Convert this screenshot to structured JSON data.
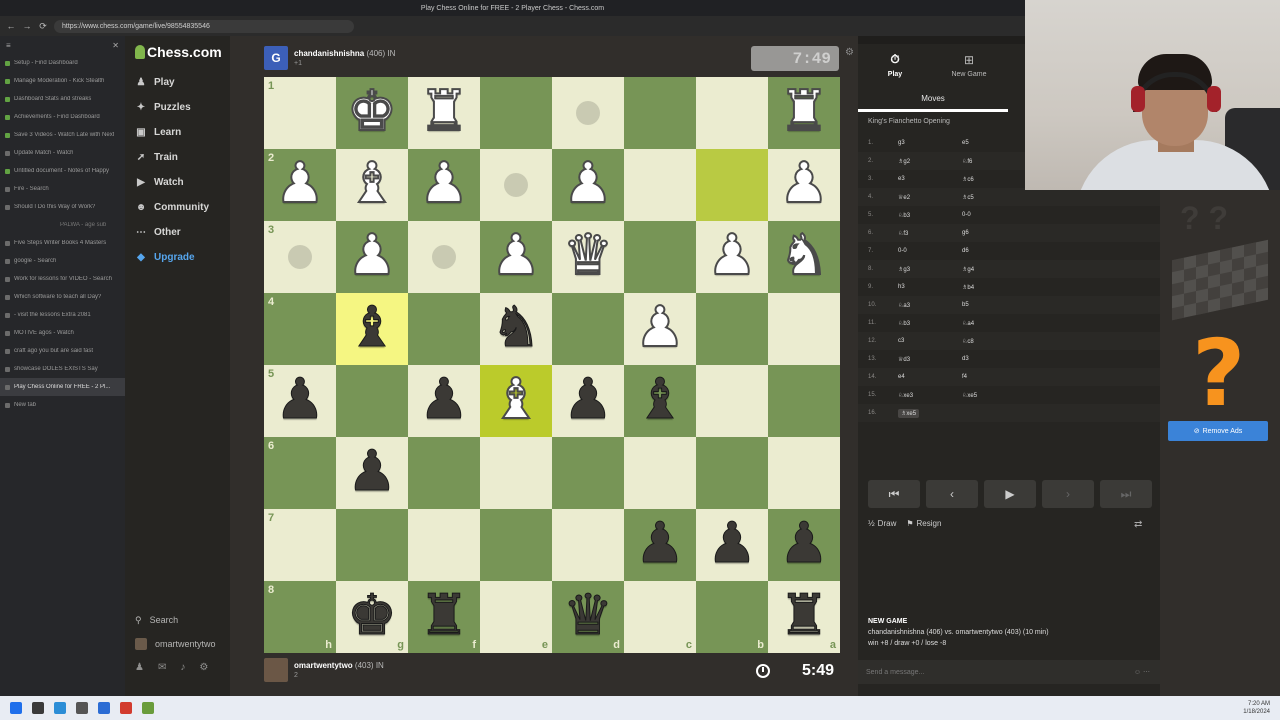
{
  "browser": {
    "window_title": "Play Chess Online for FREE - 2 Player Chess - Chess.com",
    "url": "https://www.chess.com/game/live/98554835546",
    "back_glyph": "←",
    "forward_glyph": "→",
    "reload_glyph": "⟳",
    "tabs_header_glyph": "≡",
    "tabs_close_glyph": "✕",
    "tabs": [
      {
        "label": "Setup - Find Dashboard",
        "green": true,
        "sub": false
      },
      {
        "label": "Manage Moderation - Kick Stealth",
        "green": true,
        "sub": false
      },
      {
        "label": "Dashboard Stats and streaks",
        "green": true,
        "sub": false
      },
      {
        "label": "Achievements - Find Dashboard",
        "green": true,
        "sub": false
      },
      {
        "label": "Save 3 Videos - Watch Late with Next",
        "green": true,
        "sub": false
      },
      {
        "label": "Update Match - Watch",
        "green": false,
        "sub": false
      },
      {
        "label": "Untitled document - Notes of Happy",
        "green": true,
        "sub": false
      },
      {
        "label": "Fire - Search",
        "green": false,
        "sub": false
      },
      {
        "label": "Should I Do this Way of Work?",
        "green": false,
        "sub": false
      },
      {
        "label": "PALWA - age sub",
        "green": false,
        "sub": true
      },
      {
        "label": "Five Steps Writer Books 4 Masters",
        "green": false,
        "sub": false
      },
      {
        "label": "google - Search",
        "green": false,
        "sub": false
      },
      {
        "label": "Work for lessons for VIDEO - Search",
        "green": false,
        "sub": false
      },
      {
        "label": "Which software to teach all Day?",
        "green": false,
        "sub": false
      },
      {
        "label": "- visit the lessons Extra 2081",
        "green": false,
        "sub": false
      },
      {
        "label": "MOTIVE agos - Watch",
        "green": false,
        "sub": false
      },
      {
        "label": "craft ago you but are said fast",
        "green": false,
        "sub": false
      },
      {
        "label": "showcase DOLES EXISTS Say",
        "green": false,
        "sub": false
      },
      {
        "label": "Play Chess Online for FREE - 2 Pl...",
        "green": false,
        "sub": false,
        "active": true
      },
      {
        "label": "New tab",
        "green": false,
        "sub": false
      }
    ]
  },
  "sidebar": {
    "logo": "Chess.com",
    "items": [
      {
        "label": "Play",
        "icon": "♟"
      },
      {
        "label": "Puzzles",
        "icon": "✦"
      },
      {
        "label": "Learn",
        "icon": "▣"
      },
      {
        "label": "Train",
        "icon": "➚"
      },
      {
        "label": "Watch",
        "icon": "▶"
      },
      {
        "label": "Community",
        "icon": "☻"
      },
      {
        "label": "Other",
        "icon": "⋯"
      },
      {
        "label": "Upgrade",
        "icon": "◆"
      }
    ],
    "search_label": "Search",
    "search_icon": "⚲",
    "username": "omartwentytwo",
    "bottom_icons": [
      "♟",
      "✉",
      "♪",
      "⚙"
    ]
  },
  "game": {
    "top_player": {
      "name": "chandanishnishna",
      "rating": "(406)",
      "flag": "IN",
      "avatar_letter": "G",
      "sub": "+1",
      "clock": "7:49"
    },
    "bottom_player": {
      "name": "omartwentytwo",
      "rating": "(403)",
      "flag": "IN",
      "sub": "2",
      "clock": "5:49"
    },
    "board": {
      "rank_labels": [
        "1",
        "2",
        "3",
        "4",
        "5",
        "6",
        "7",
        "8"
      ],
      "file_labels": [
        "h",
        "g",
        "f",
        "e",
        "d",
        "c",
        "b",
        "a"
      ],
      "pieces": [
        [
          "",
          "wK",
          "wR",
          "",
          ".",
          "",
          "",
          "wR"
        ],
        [
          "wP",
          "wB",
          "wP",
          ".",
          "wP",
          "",
          "",
          "wP"
        ],
        [
          ".",
          "wP",
          ".",
          "wP",
          "wQ",
          "",
          "wP",
          "wN"
        ],
        [
          "",
          "bB",
          "",
          "bN",
          "",
          "wP",
          "",
          ""
        ],
        [
          "bP",
          "",
          "bP",
          "wB",
          "bP",
          "bB",
          "",
          ""
        ],
        [
          "",
          "bP",
          "",
          "",
          "",
          "",
          "",
          ""
        ],
        [
          "",
          "",
          "",
          "",
          "",
          "bP",
          "bP",
          "bP"
        ],
        [
          "",
          "bK",
          "bR",
          "",
          "bQ",
          "",
          "",
          "bR"
        ]
      ],
      "highlights": [
        {
          "r": 1,
          "c": 6,
          "kind": "hl-dark"
        },
        {
          "r": 3,
          "c": 1,
          "kind": "hl-light"
        },
        {
          "r": 4,
          "c": 3,
          "kind": "hl-dark2"
        }
      ]
    }
  },
  "panel": {
    "tabs": [
      {
        "label": "Play",
        "icon": "⏱",
        "active": true
      },
      {
        "label": "New Game",
        "icon": "⊞",
        "active": false
      }
    ],
    "moves_header": "Moves",
    "opening": "King's Fianchetto Opening",
    "moves": [
      {
        "n": "1.",
        "w": "g3",
        "b": "e5"
      },
      {
        "n": "2.",
        "w": "♗g2",
        "b": "♘f6"
      },
      {
        "n": "3.",
        "w": "e3",
        "b": "♗c6"
      },
      {
        "n": "4.",
        "w": "♕e2",
        "b": "♗c5"
      },
      {
        "n": "5.",
        "w": "♘b3",
        "b": "0-0"
      },
      {
        "n": "6.",
        "w": "♘f3",
        "b": "g6"
      },
      {
        "n": "7.",
        "w": "0-0",
        "b": "d6"
      },
      {
        "n": "8.",
        "w": "♗g3",
        "b": "♗g4"
      },
      {
        "n": "9.",
        "w": "h3",
        "b": "♗b4"
      },
      {
        "n": "10.",
        "w": "♘a3",
        "b": "b5"
      },
      {
        "n": "11.",
        "w": "♘b3",
        "b": "♘a4"
      },
      {
        "n": "12.",
        "w": "c3",
        "b": "♘c8"
      },
      {
        "n": "13.",
        "w": "♕d3",
        "b": "d3"
      },
      {
        "n": "14.",
        "w": "e4",
        "b": "f4"
      },
      {
        "n": "15.",
        "w": "♘xe3",
        "b": "♘xe5"
      },
      {
        "n": "16.",
        "w": "♗xe5",
        "b": "",
        "current": true
      }
    ],
    "nav_buttons": [
      "⏮",
      "‹",
      "▶",
      "›",
      "⏭"
    ],
    "draw_label": "Draw",
    "draw_icon": "½",
    "resign_label": "Resign",
    "resign_icon": "⚑",
    "flip_icon": "⇄",
    "new_game_title": "NEW GAME",
    "new_game_line": "chandanishnishna (406) vs. omartwentytwo (403) (10 min)",
    "new_game_stats": "win +8 / draw +0 / lose -8",
    "chat_placeholder": "Send a message...",
    "chat_icons": "☺ ⋯"
  },
  "ad": {
    "ghost": "? ?",
    "question": "?",
    "remove_ads_label": "Remove Ads",
    "remove_ads_icon": "⊘"
  },
  "taskbar": {
    "time": "7:20 AM",
    "date": "1/18/2024",
    "icons": [
      "#1f6feb",
      "#3a3a3a",
      "#2b8dd6",
      "#555",
      "#2b6cd4",
      "#d23b2e",
      "#6a9c3b"
    ]
  },
  "colors": {
    "board_light": "#ebecd0",
    "board_dark": "#779556",
    "accent_green": "#81b64c",
    "orange": "#f7931e",
    "blue": "#3b83d8"
  }
}
